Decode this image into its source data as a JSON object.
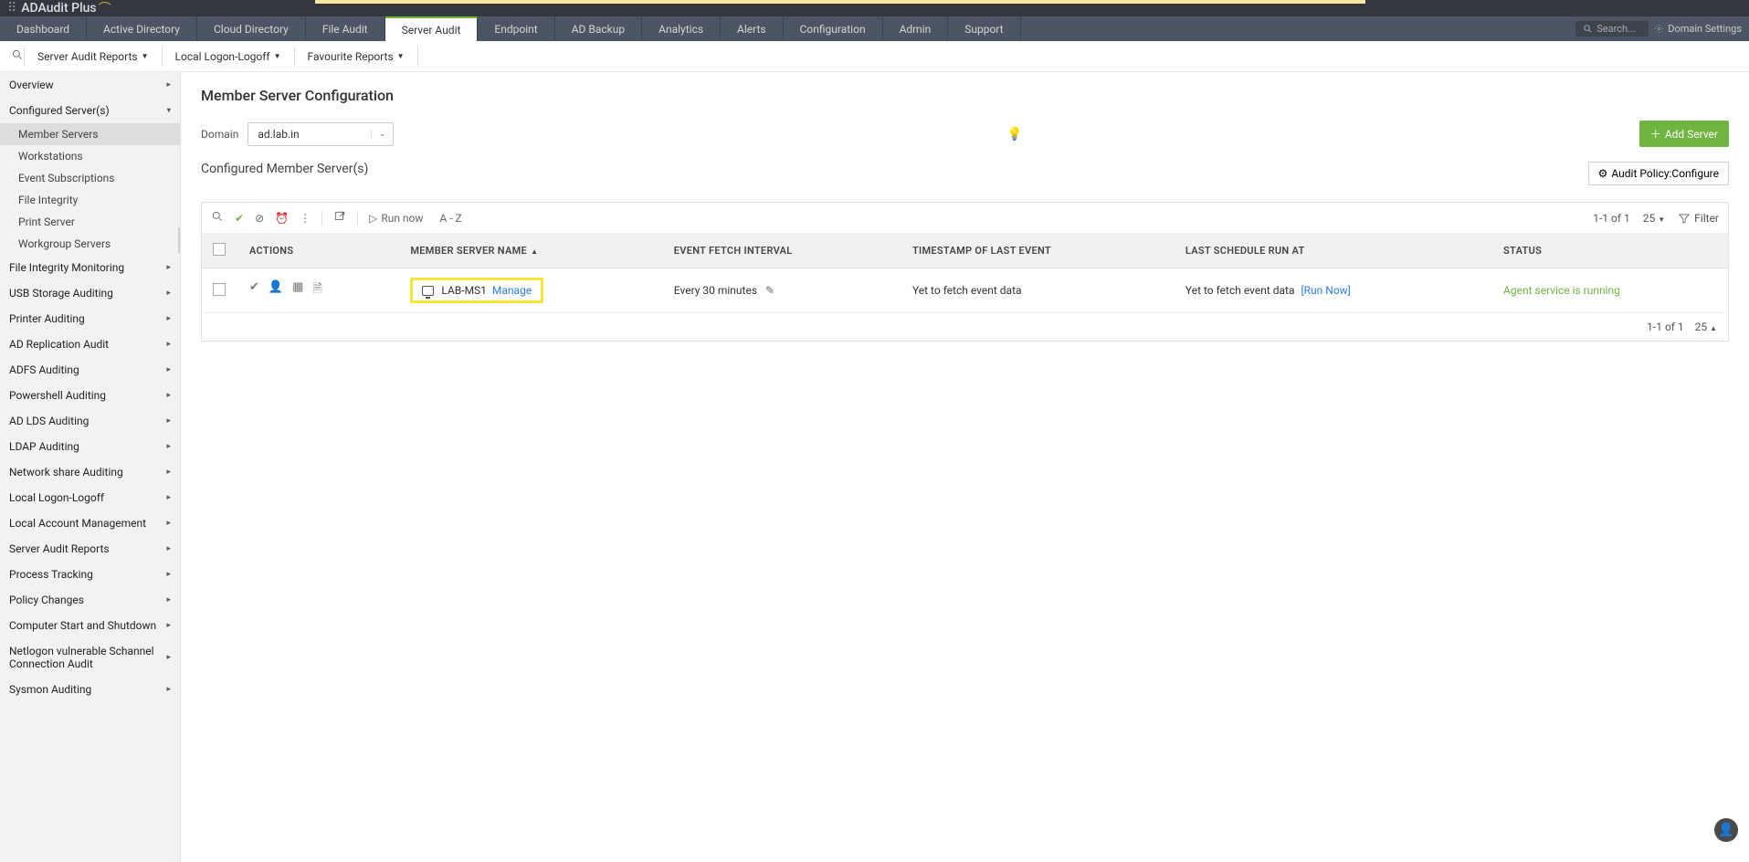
{
  "brand": "ADAudit Plus",
  "nav": {
    "tabs": [
      "Dashboard",
      "Active Directory",
      "Cloud Directory",
      "File Audit",
      "Server Audit",
      "Endpoint",
      "AD Backup",
      "Analytics",
      "Alerts",
      "Configuration",
      "Admin",
      "Support"
    ],
    "active_index": 4,
    "search_placeholder": "Search...",
    "domain_settings": "Domain Settings"
  },
  "secbar": {
    "reports_dd": "Server Audit Reports",
    "logon_dd": "Local Logon-Logoff",
    "fav_dd": "Favourite Reports"
  },
  "sidebar": {
    "groups": [
      {
        "label": "Overview",
        "expanded": false
      },
      {
        "label": "Configured Server(s)",
        "expanded": true,
        "subs": [
          {
            "label": "Member Servers",
            "active": true
          },
          {
            "label": "Workstations"
          },
          {
            "label": "Event Subscriptions"
          },
          {
            "label": "File Integrity"
          },
          {
            "label": "Print Server"
          },
          {
            "label": "Workgroup Servers"
          }
        ]
      },
      {
        "label": "File Integrity Monitoring"
      },
      {
        "label": "USB Storage Auditing"
      },
      {
        "label": "Printer Auditing"
      },
      {
        "label": "AD Replication Audit"
      },
      {
        "label": "ADFS Auditing"
      },
      {
        "label": "Powershell Auditing"
      },
      {
        "label": "AD LDS Auditing"
      },
      {
        "label": "LDAP Auditing"
      },
      {
        "label": "Network share Auditing"
      },
      {
        "label": "Local Logon-Logoff"
      },
      {
        "label": "Local Account Management"
      },
      {
        "label": "Server Audit Reports"
      },
      {
        "label": "Process Tracking"
      },
      {
        "label": "Policy Changes"
      },
      {
        "label": "Computer Start and Shutdown"
      },
      {
        "label": "Netlogon vulnerable Schannel Connection Audit"
      },
      {
        "label": "Sysmon Auditing"
      }
    ]
  },
  "page": {
    "title": "Member Server Configuration",
    "domain_label": "Domain",
    "domain_value": "ad.lab.in",
    "add_server": "Add Server",
    "section_title": "Configured Member Server(s)",
    "audit_policy": "Audit Policy:Configure"
  },
  "toolbar": {
    "run_now": "Run now",
    "az": "A - Z",
    "page_info": "1-1 of 1",
    "page_size": "25",
    "filter": "Filter"
  },
  "table": {
    "headers": {
      "actions": "ACTIONS",
      "name": "MEMBER SERVER NAME",
      "interval": "EVENT FETCH INTERVAL",
      "timestamp": "TIMESTAMP OF LAST EVENT",
      "schedule": "LAST SCHEDULE RUN AT",
      "status": "STATUS"
    },
    "rows": [
      {
        "name": "LAB-MS1",
        "manage": "Manage",
        "interval": "Every 30 minutes",
        "timestamp": "Yet to fetch event data",
        "schedule": "Yet to fetch event data",
        "schedule_link": "[Run Now]",
        "status": "Agent service is running"
      }
    ],
    "footer_page": "1-1 of 1",
    "footer_size": "25"
  }
}
